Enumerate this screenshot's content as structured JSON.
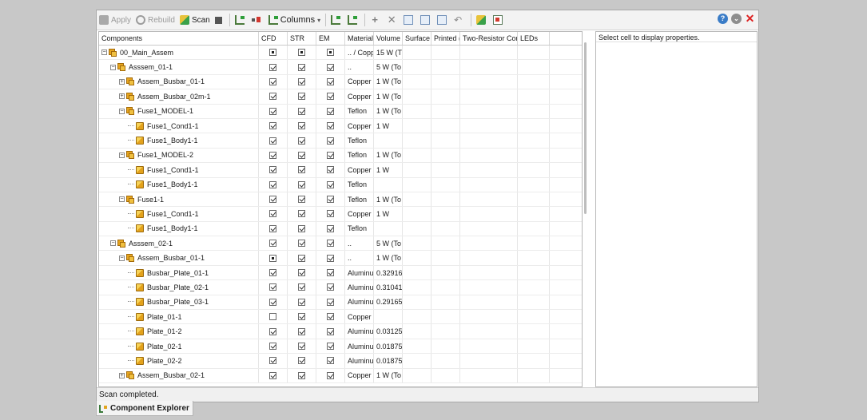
{
  "toolbar": {
    "apply_label": "Apply",
    "rebuild_label": "Rebuild",
    "scan_label": "Scan",
    "columns_label": "Columns"
  },
  "grid": {
    "headers": [
      "Components",
      "CFD",
      "STR",
      "EM",
      "Material",
      "Volume",
      "Surface",
      "Printed (",
      "Two-Resistor Cor",
      "LEDs"
    ],
    "rows": [
      {
        "depth": 0,
        "exp": "minus",
        "icon": "assembly-icon",
        "name": "00_Main_Assem",
        "cfd": "fill",
        "str": "fill",
        "em": "fill",
        "material": ".. / Copp",
        "volume": "15 W (T"
      },
      {
        "depth": 1,
        "exp": "minus",
        "icon": "assembly-icon",
        "name": "Asssem_01-1",
        "cfd": "check",
        "str": "check",
        "em": "check",
        "material": "..",
        "volume": "5 W (To"
      },
      {
        "depth": 2,
        "exp": "plus",
        "icon": "assembly-icon",
        "name": "Assem_Busbar_01-1",
        "cfd": "check",
        "str": "check",
        "em": "check",
        "material": "Copper",
        "volume": "1 W (To"
      },
      {
        "depth": 2,
        "exp": "plus",
        "icon": "assembly-icon",
        "name": "Assem_Busbar_02m-1",
        "cfd": "check",
        "str": "check",
        "em": "check",
        "material": "Copper",
        "volume": "1 W (To"
      },
      {
        "depth": 2,
        "exp": "minus",
        "icon": "assembly-icon",
        "name": "Fuse1_MODEL-1",
        "cfd": "check",
        "str": "check",
        "em": "check",
        "material": "Teflon",
        "volume": "1 W (To"
      },
      {
        "depth": 3,
        "exp": "none",
        "icon": "part-icon",
        "name": "Fuse1_Cond1-1",
        "cfd": "check",
        "str": "check",
        "em": "check",
        "material": "Copper",
        "volume": "1 W"
      },
      {
        "depth": 3,
        "exp": "none",
        "icon": "part-icon",
        "name": "Fuse1_Body1-1",
        "cfd": "check",
        "str": "check",
        "em": "check",
        "material": "Teflon",
        "volume": ""
      },
      {
        "depth": 2,
        "exp": "minus",
        "icon": "assembly-icon",
        "name": "Fuse1_MODEL-2",
        "cfd": "check",
        "str": "check",
        "em": "check",
        "material": "Teflon",
        "volume": "1 W (To"
      },
      {
        "depth": 3,
        "exp": "none",
        "icon": "part-icon",
        "name": "Fuse1_Cond1-1",
        "cfd": "check",
        "str": "check",
        "em": "check",
        "material": "Copper",
        "volume": "1 W"
      },
      {
        "depth": 3,
        "exp": "none",
        "icon": "part-icon",
        "name": "Fuse1_Body1-1",
        "cfd": "check",
        "str": "check",
        "em": "check",
        "material": "Teflon",
        "volume": ""
      },
      {
        "depth": 2,
        "exp": "minus",
        "icon": "assembly-icon",
        "name": "Fuse1-1",
        "cfd": "check",
        "str": "check",
        "em": "check",
        "material": "Teflon",
        "volume": "1 W (To"
      },
      {
        "depth": 3,
        "exp": "none",
        "icon": "part-icon",
        "name": "Fuse1_Cond1-1",
        "cfd": "check",
        "str": "check",
        "em": "check",
        "material": "Copper",
        "volume": "1 W"
      },
      {
        "depth": 3,
        "exp": "none",
        "icon": "part-icon",
        "name": "Fuse1_Body1-1",
        "cfd": "check",
        "str": "check",
        "em": "check",
        "material": "Teflon",
        "volume": ""
      },
      {
        "depth": 1,
        "exp": "minus",
        "icon": "assembly-icon",
        "name": "Asssem_02-1",
        "cfd": "check",
        "str": "check",
        "em": "check",
        "material": "..",
        "volume": "5 W (To"
      },
      {
        "depth": 2,
        "exp": "minus",
        "icon": "assembly-icon",
        "name": "Assem_Busbar_01-1",
        "cfd": "fill",
        "str": "check",
        "em": "check",
        "material": "..",
        "volume": "1 W (To"
      },
      {
        "depth": 3,
        "exp": "none",
        "icon": "part-icon",
        "name": "Busbar_Plate_01-1",
        "cfd": "check",
        "str": "check",
        "em": "check",
        "material": "Aluminu",
        "volume": "0.32916!"
      },
      {
        "depth": 3,
        "exp": "none",
        "icon": "part-icon",
        "name": "Busbar_Plate_02-1",
        "cfd": "check",
        "str": "check",
        "em": "check",
        "material": "Aluminu",
        "volume": "0.31041:"
      },
      {
        "depth": 3,
        "exp": "none",
        "icon": "part-icon",
        "name": "Busbar_Plate_03-1",
        "cfd": "check",
        "str": "check",
        "em": "check",
        "material": "Aluminu",
        "volume": "0.29165!"
      },
      {
        "depth": 3,
        "exp": "none",
        "icon": "part-icon",
        "name": "Plate_01-1",
        "cfd": "empty",
        "str": "check",
        "em": "check",
        "material": "Copper",
        "volume": ""
      },
      {
        "depth": 3,
        "exp": "none",
        "icon": "part-icon",
        "name": "Plate_01-2",
        "cfd": "check",
        "str": "check",
        "em": "check",
        "material": "Aluminu",
        "volume": "0.03125("
      },
      {
        "depth": 3,
        "exp": "none",
        "icon": "part-icon",
        "name": "Plate_02-1",
        "cfd": "check",
        "str": "check",
        "em": "check",
        "material": "Aluminu",
        "volume": "0.01875:"
      },
      {
        "depth": 3,
        "exp": "none",
        "icon": "part-icon",
        "name": "Plate_02-2",
        "cfd": "check",
        "str": "check",
        "em": "check",
        "material": "Aluminu",
        "volume": "0.01875:"
      },
      {
        "depth": 2,
        "exp": "plus",
        "icon": "assembly-icon",
        "name": "Assem_Busbar_02-1",
        "cfd": "check",
        "str": "check",
        "em": "check",
        "material": "Copper",
        "volume": "1 W (To"
      }
    ]
  },
  "properties": {
    "placeholder": "Select cell to display properties."
  },
  "status": {
    "text": "Scan completed."
  },
  "bottom_tab": {
    "label": "Component Explorer"
  }
}
